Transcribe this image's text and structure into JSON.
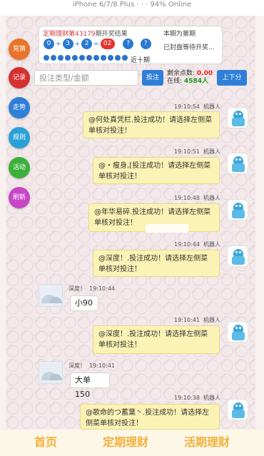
{
  "status_bar": {
    "text": "iPhone 6/7/8 Plus  ·  · ·  94% Online"
  },
  "side_buttons": [
    {
      "label": "竞猜",
      "color": "#e8732a"
    },
    {
      "label": "记录",
      "color": "#d43030"
    },
    {
      "label": "走势",
      "color": "#2f7fd8"
    },
    {
      "label": "规则",
      "color": "#2aa1d6"
    },
    {
      "label": "活动",
      "color": "#3bb03b"
    },
    {
      "label": "刷新",
      "color": "#c845c6"
    }
  ],
  "lottery": {
    "period_prefix": "定期理财第",
    "period_num": "43179",
    "period_suffix": "期开奖结果",
    "next_period": "本期为第期",
    "status_text": "已封盘等待开奖...",
    "balls": [
      "0",
      "3",
      "2",
      "02"
    ],
    "ops": [
      "+",
      "+",
      "="
    ],
    "unknown_1": "?",
    "unknown_2": "?",
    "recent_label": "近十期"
  },
  "bet_bar": {
    "placeholder": "投注类型/金额",
    "bet_button": "投注",
    "points_label": "剩余点数:",
    "points_value": "0.00",
    "online_label": "在线:",
    "online_value": "4584人",
    "updown_button": "上下分"
  },
  "messages": [
    {
      "time": "19:10:54",
      "sender": "机器人",
      "text": "@何处真凭栏.投注成功！请选择左侧菜单核对投注！"
    },
    {
      "time": "19:10:51",
      "sender": "机器人",
      "text": "@・瘦身,[投注成功！请选择左侧菜单核对投注！"
    },
    {
      "time": "19:10:48",
      "sender": "机器人",
      "text": "@年华易碎.投注成功！请选择左侧菜单核对投注！"
    },
    {
      "time": "19:10:44",
      "sender": "机器人",
      "text": "@深度！.投注成功！请选择左侧菜单核对投注！"
    },
    {
      "time": "19:10:44",
      "sender": "深度！",
      "text": "小90"
    },
    {
      "time": "19:10:41",
      "sender": "机器人",
      "text": "@深度！.投注成功！请选择左侧菜单核对投注！"
    },
    {
      "time": "19:10:41",
      "sender": "深度！",
      "text": "大单150"
    },
    {
      "time": "19:10:38",
      "sender": "机器人",
      "text": "@歌命的つ蓄葉丶.投注成功！请选择左侧菜单核对投注！"
    }
  ],
  "bottom_nav": [
    "首页",
    "定期理财",
    "活期理财"
  ]
}
